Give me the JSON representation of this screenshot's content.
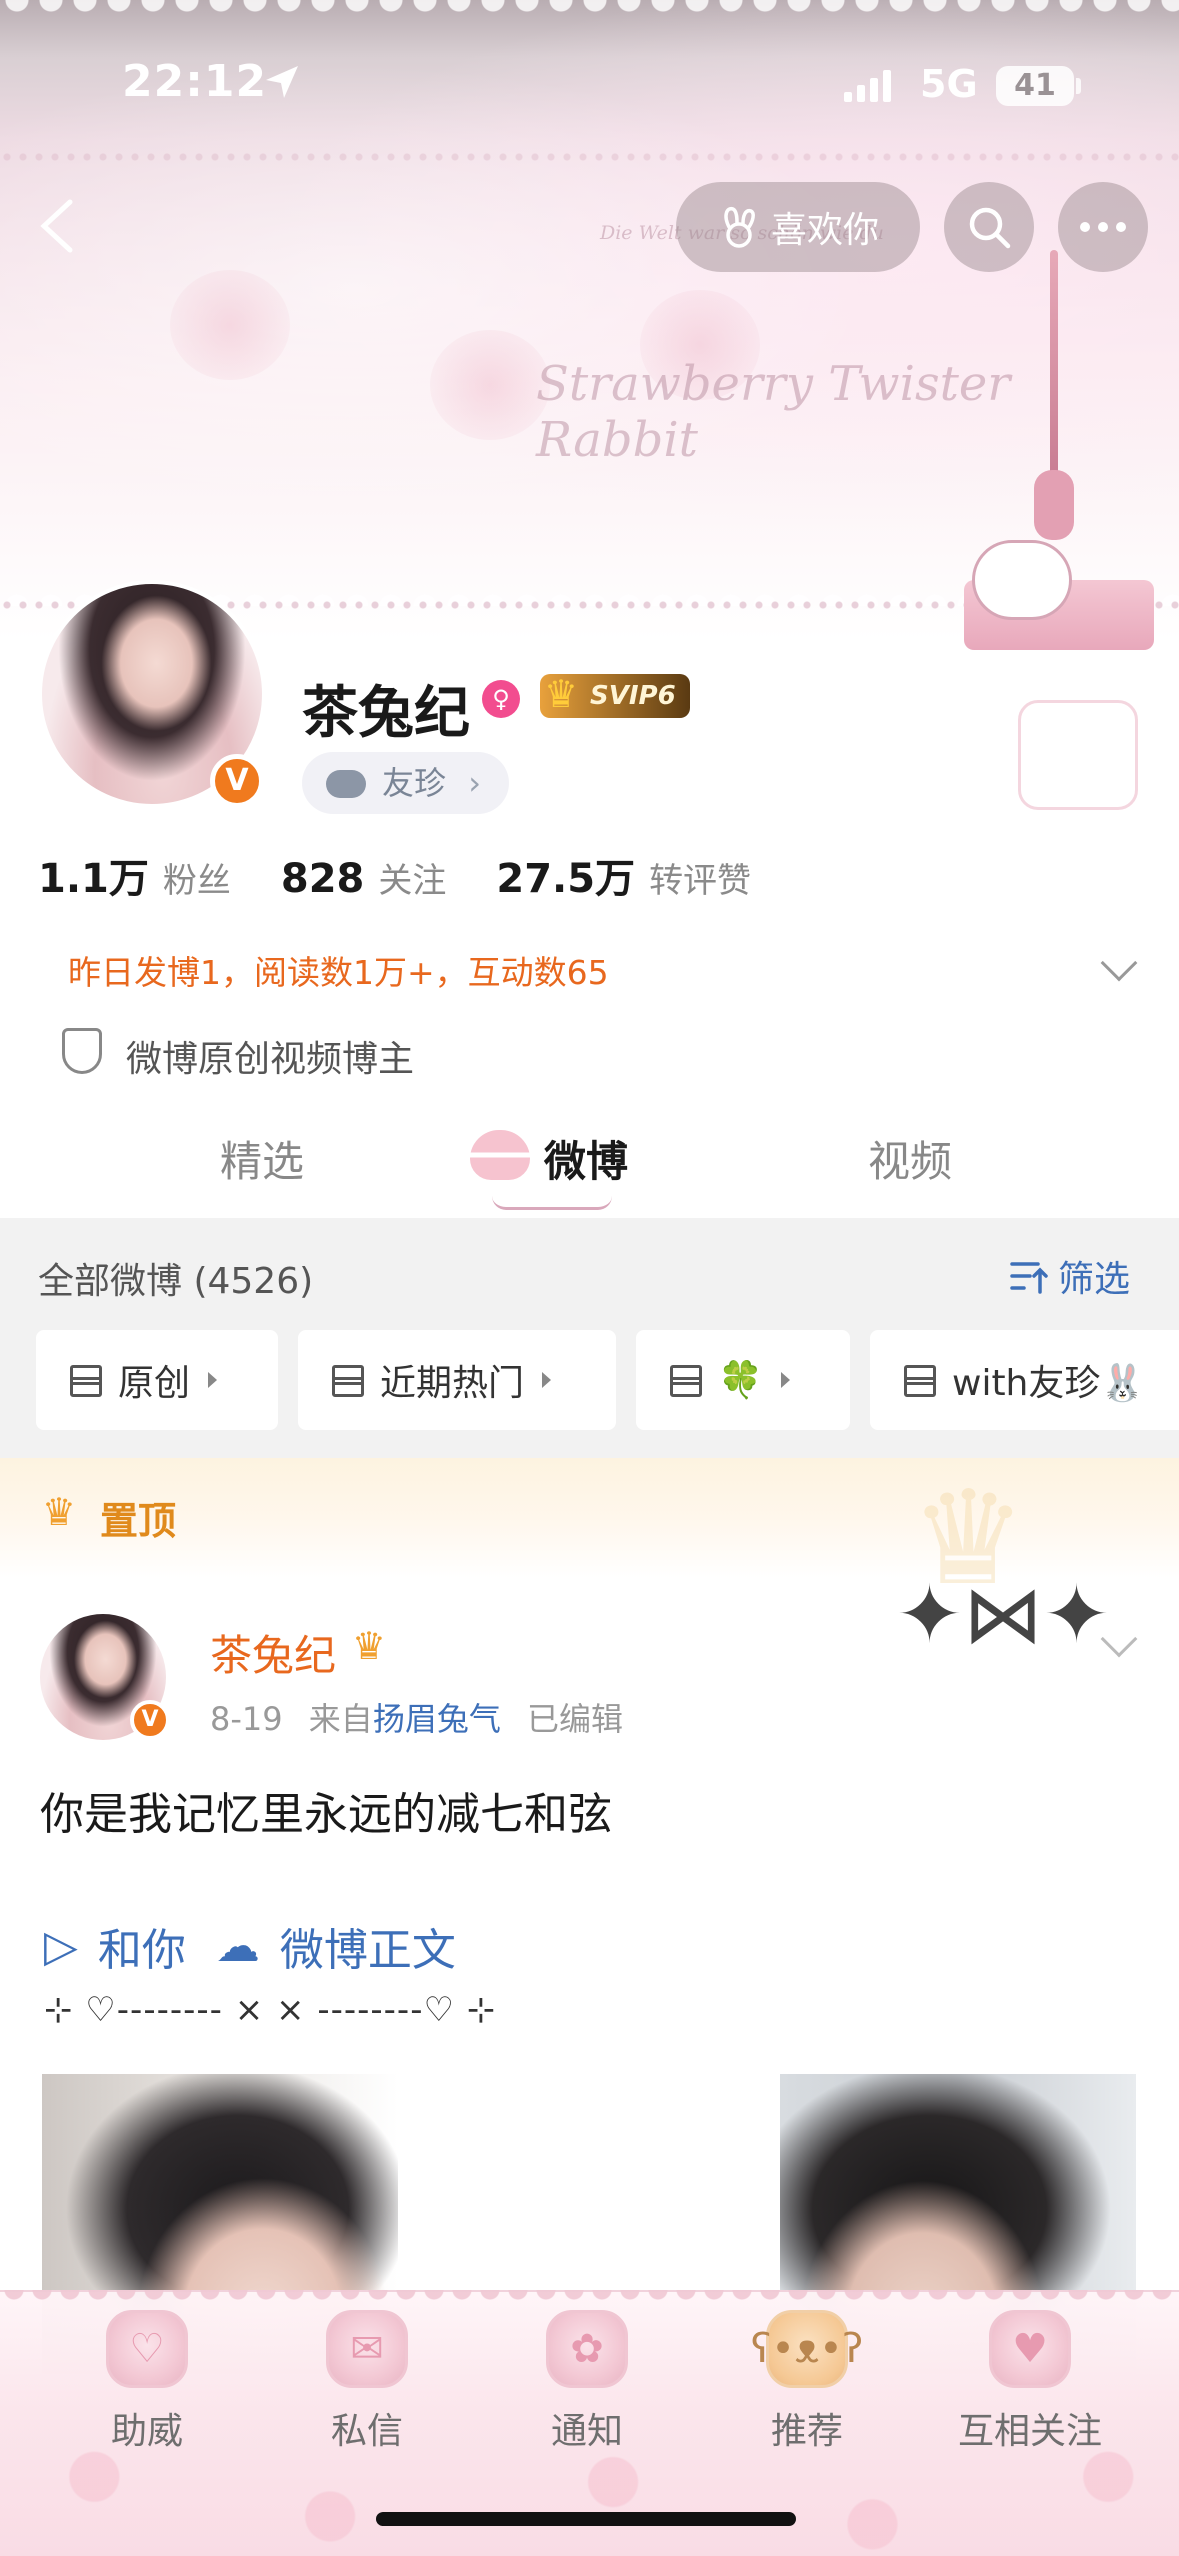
{
  "status_bar": {
    "time": "22:12",
    "network": "5G",
    "battery": "41"
  },
  "header": {
    "like_label": "喜欢你",
    "banner_script": "Strawberry Twister Rabbit",
    "banner_small": "Die Welt war so schön wie du"
  },
  "profile": {
    "name": "茶兔纪",
    "svip": "SVIP6",
    "fan_group": "友珍",
    "stats": [
      {
        "value": "1.1万",
        "label": "粉丝"
      },
      {
        "value": "828",
        "label": "关注"
      },
      {
        "value": "27.5万",
        "label": "转评赞"
      }
    ],
    "activity": "昨日发博1，阅读数1万+，互动数65",
    "certification": "微博原创视频博主"
  },
  "tabs": [
    {
      "label": "精选"
    },
    {
      "label": "微博"
    },
    {
      "label": "视频"
    }
  ],
  "feed_filter": {
    "all_posts": "全部微博 (4526)",
    "filter_label": "筛选",
    "chips": [
      {
        "label": "原创"
      },
      {
        "label": "近期热门"
      },
      {
        "label": "🍀"
      },
      {
        "label": "with友珍🐰"
      }
    ]
  },
  "pinned": {
    "label": "置顶",
    "post": {
      "author": "茶兔纪",
      "date": "8-19",
      "from_prefix": "来自",
      "source": "扬眉兔气",
      "edited": "已编辑",
      "text": "你是我记忆里永远的减七和弦",
      "link_1": "和你",
      "link_2": "微博正文",
      "decoration": "⊹ ♡-------- ⨯ ⨯ --------♡ ⊹"
    }
  },
  "bottom_nav": [
    {
      "label": "助威"
    },
    {
      "label": "私信"
    },
    {
      "label": "通知"
    },
    {
      "label": "推荐"
    },
    {
      "label": "互相关注"
    }
  ],
  "colors": {
    "accent_orange": "#e8681e",
    "link_blue": "#3d6fb8",
    "pink_theme": "#f6c3cf"
  }
}
